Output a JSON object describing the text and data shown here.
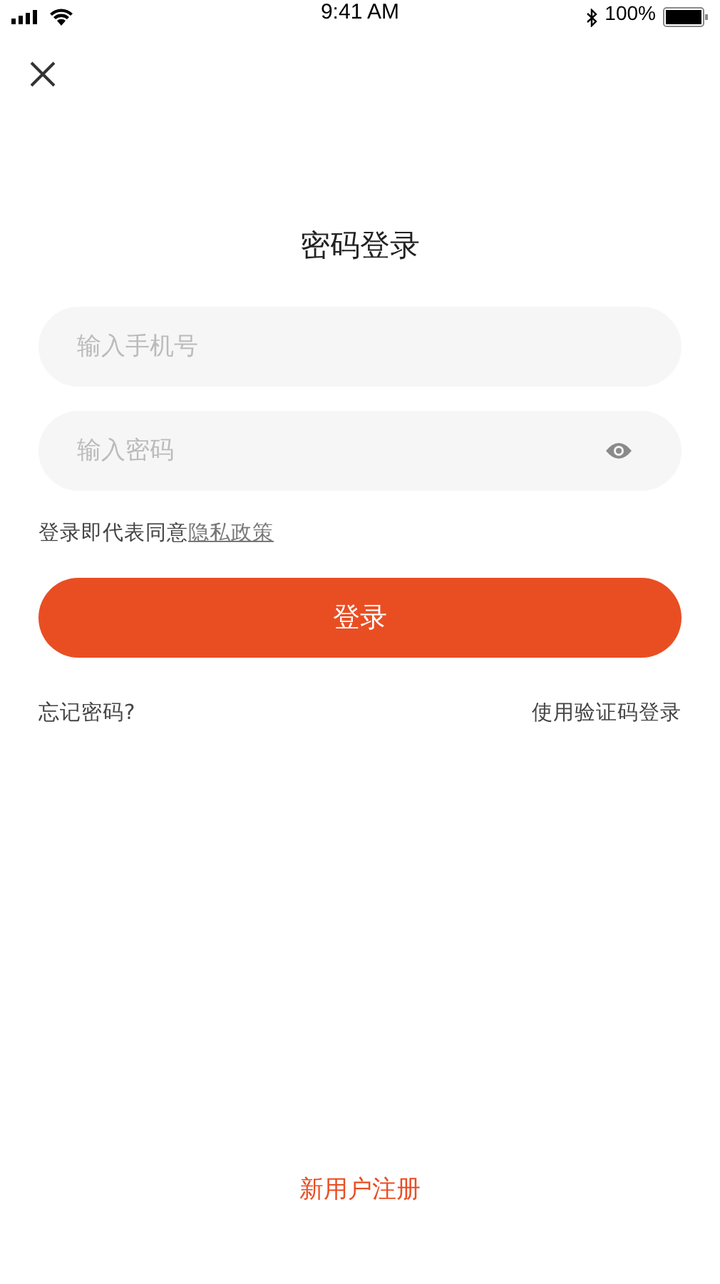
{
  "status_bar": {
    "time": "9:41 AM",
    "battery": "100%"
  },
  "title": "密码登录",
  "phone_field": {
    "placeholder": "输入手机号"
  },
  "password_field": {
    "placeholder": "输入密码"
  },
  "agreement": {
    "text": "登录即代表同意",
    "link": "隐私政策"
  },
  "login_button": "登录",
  "links": {
    "forgot": "忘记密码?",
    "sms_login": "使用验证码登录"
  },
  "register": "新用户注册"
}
